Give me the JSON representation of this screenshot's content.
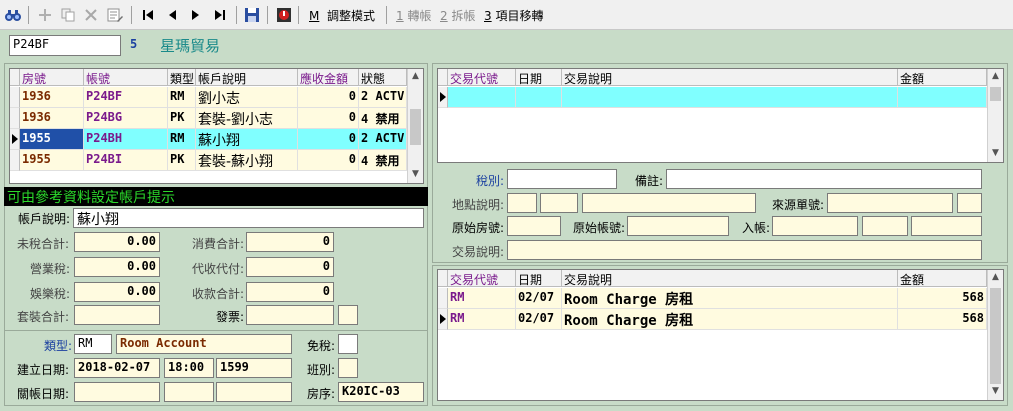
{
  "toolbar": {
    "icons": [
      "binoculars-icon",
      "add-icon",
      "copy-icon",
      "delete-icon",
      "edit-list-icon",
      "first-icon",
      "prev-icon",
      "next-icon",
      "last-icon",
      "save-icon",
      "exit-icon"
    ],
    "adjust_key": "M",
    "adjust_label": "調整模式",
    "transfer_key": "1",
    "transfer_label": "轉帳",
    "split_key": "2",
    "split_label": "拆帳",
    "move_key": "3",
    "move_label": "項目移轉"
  },
  "header": {
    "account_code": "P24BF",
    "count": "5",
    "company_name": "星瑪貿易"
  },
  "account_table": {
    "columns": [
      "房號",
      "帳號",
      "類型",
      "帳戶說明",
      "應收金額",
      "狀態"
    ],
    "rows": [
      {
        "room": "1936",
        "account": "P24BF",
        "type": "RM",
        "desc": "劉小志",
        "amount": "0",
        "status": "2 ACTV"
      },
      {
        "room": "1936",
        "account": "P24BG",
        "type": "PK",
        "desc": "套裝-劉小志",
        "amount": "0",
        "status": "4 禁用"
      },
      {
        "room": "1955",
        "account": "P24BH",
        "type": "RM",
        "desc": "蘇小翔",
        "amount": "0",
        "status": "2 ACTV"
      },
      {
        "room": "1955",
        "account": "P24BI",
        "type": "PK",
        "desc": "套裝-蘇小翔",
        "amount": "0",
        "status": "4 禁用"
      }
    ]
  },
  "hint": "可由參考資料設定帳戶提示",
  "detail": {
    "desc_label": "帳戶說明:",
    "desc_value": "蘇小翔",
    "pretax_label": "未稅合計:",
    "pretax_value": "0.00",
    "consume_label": "消費合計:",
    "consume_value": "0",
    "business_tax_label": "營業稅:",
    "business_tax_value": "0.00",
    "collect_label": "代收代付:",
    "collect_value": "0",
    "entertainment_tax_label": "娛樂稅:",
    "entertainment_tax_value": "0.00",
    "receipt_label": "收款合計:",
    "receipt_value": "0",
    "package_label": "套裝合計:",
    "package_value": "",
    "invoice_label": "發票:",
    "invoice_value": "",
    "invoice_extra": "",
    "type_label": "類型:",
    "type_code": "RM",
    "type_name": "Room Account",
    "tax_free_label": "免稅:",
    "tax_free_value": "",
    "created_label": "建立日期:",
    "created_date": "2018-02-07",
    "created_time": "18:00",
    "created_no": "1599",
    "shift_label": "班別:",
    "shift_value": "",
    "closed_label": "關帳日期:",
    "closed_date": "",
    "closed_time": "",
    "closed_no": "",
    "room_seq_label": "房序:",
    "room_seq_value": "K20IC-03"
  },
  "top_right_table": {
    "columns": [
      "交易代號",
      "日期",
      "交易說明",
      "金額"
    ]
  },
  "mid_right": {
    "tax_label": "稅別:",
    "tax_value": "",
    "note_label": "備註:",
    "note_value": "",
    "location_label": "地點說明:",
    "source_label": "來源單號:",
    "orig_room_label": "原始房號:",
    "orig_account_label": "原始帳號:",
    "posting_label": "入帳:",
    "tx_desc_label": "交易說明:"
  },
  "bottom_right_table": {
    "columns": [
      "交易代號",
      "日期",
      "交易說明",
      "金額"
    ],
    "rows": [
      {
        "code": "RM",
        "date": "02/07",
        "desc": "Room Charge 房租",
        "amount": "568"
      },
      {
        "code": "RM",
        "date": "02/07",
        "desc": "Room Charge 房租",
        "amount": "568"
      }
    ]
  },
  "colors": {
    "background": "#c8dcc8",
    "highlight_row": "#80ffff",
    "selected_cell": "#2050a8",
    "field_yellow": "#fffbe0",
    "accent_purple": "#7a1a8c"
  }
}
